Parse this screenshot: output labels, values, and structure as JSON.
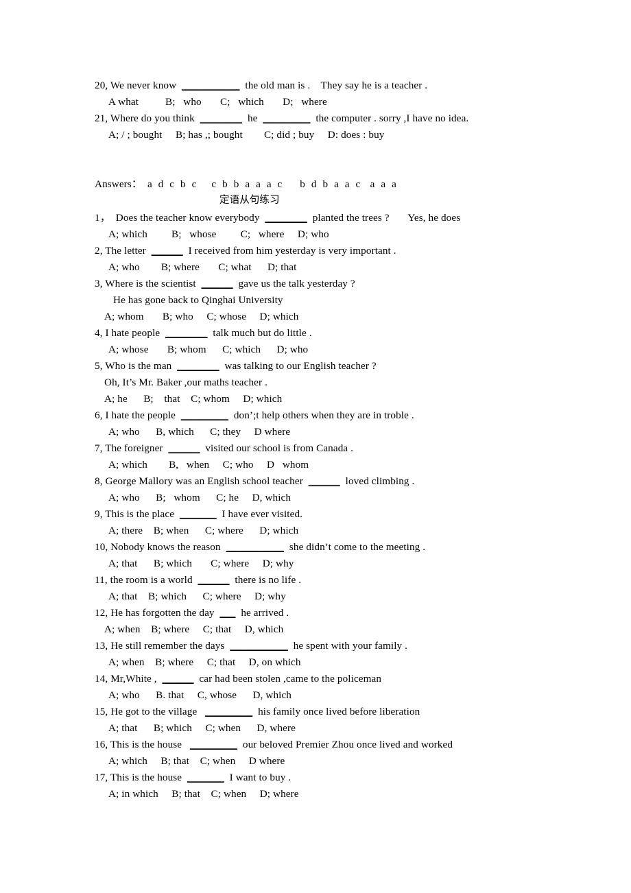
{
  "document": {
    "top_section": {
      "questions": [
        {
          "number": "20,",
          "stem_before": "We never know",
          "blank": "___________",
          "stem_after": "the old man is .    They say he is a teacher .",
          "options": "A what          B;   who       C;   which       D;   where"
        },
        {
          "number": "21,",
          "stem_before": "Where do you think",
          "blank": "________",
          "stem_mid": "he",
          "blank2": "_________",
          "stem_after": "the computer . sorry ,I have no idea.",
          "options": "A; / ; bought     B; has ,; bought        C; did ; buy     D: does : buy"
        }
      ]
    },
    "answers": {
      "label": "Answers：",
      "groups": [
        "a d c b c",
        "c b b a a a c",
        "b d b a a c",
        "a a a"
      ]
    },
    "section_title": "定语从句练习",
    "exercises": [
      {
        "number": "1，",
        "text_before": "Does the teacher know everybody",
        "blank": "________",
        "text_after": "planted the trees ?       Yes, he does",
        "options": "A; which         B;   whose         C;   where     D; who"
      },
      {
        "number": "2,",
        "text_before": "The letter",
        "blank": "______",
        "text_after": "I received from him yesterday is very important .",
        "options": "A; who        B; where       C; what      D; that"
      },
      {
        "number": "3,",
        "text_before": "Where is the scientist",
        "blank": "______",
        "text_after": "gave us the talk yesterday ?",
        "sub_line": "He has gone back to Qinghai University",
        "options": "A; whom       B; who     C; whose     D; which"
      },
      {
        "number": "4,",
        "text_before": "I hate people",
        "blank": "________",
        "text_after": "talk much but do little .",
        "options": "A; whose       B; whom      C; which      D; who"
      },
      {
        "number": "5,",
        "text_before": "Who is the man",
        "blank": "________",
        "text_after": "was talking to our English teacher ?",
        "sub_line": "Oh, It’s Mr. Baker ,our maths teacher .",
        "options": "A; he      B;    that    C; whom     D; which"
      },
      {
        "number": "6,",
        "text_before": "I hate the people",
        "blank": "_________",
        "text_after": "don’;t help others when they are in troble .",
        "options": "A; who      B, which      C; they     D where"
      },
      {
        "number": "7,",
        "text_before": "The foreigner",
        "blank": "______",
        "text_after": "visited our school is from Canada .",
        "options": "A; which        B,   when     C; who     D   whom"
      },
      {
        "number": "8,",
        "text_before": "George Mallory was an English school teacher",
        "blank": "______",
        "text_after": "loved climbing .",
        "options": "A; who      B;   whom      C; he     D, which"
      },
      {
        "number": "9,",
        "text_before": "This is the place",
        "blank": "_______",
        "text_after": "I have ever visited.",
        "options": "A; there    B; when      C; where      D; which"
      },
      {
        "number": "10,",
        "text_before": "Nobody knows the reason",
        "blank": "___________",
        "text_after": "she didn’t come to the meeting .",
        "options": "A; that      B; which       C; where     D; why"
      },
      {
        "number": "11,",
        "text_before": "the room is a world",
        "blank": "______",
        "text_after": "there is no life .",
        "options": "A; that    B; which      C; where     D; why"
      },
      {
        "number": "12,",
        "text_before": "He has forgotten the day",
        "blank": "___",
        "text_after": "he arrived .",
        "options": "A; when    B; where     C; that     D, which"
      },
      {
        "number": "13,",
        "text_before": "He still remember the days",
        "blank": "___________",
        "text_after": "he spent with your family .",
        "options": "A; when    B; where     C; that     D, on which"
      },
      {
        "number": "14,",
        "text_before": "Mr,White ,",
        "blank": "______",
        "text_after": "car had been stolen ,came to the policeman",
        "options": "A; who      B. that     C, whose      D, which"
      },
      {
        "number": "15,",
        "text_before": "He got to the village",
        "blank": "_________",
        "text_after": "his family once lived before liberation",
        "options": "A; that      B; which     C; when      D, where"
      },
      {
        "number": "16,",
        "text_before": "This is the house",
        "blank": "_________",
        "text_after": "our beloved Premier Zhou once lived and worked",
        "options": "A; which     B; that    C; when     D where"
      },
      {
        "number": "17,",
        "text_before": "This is the house",
        "blank": "_______",
        "text_after": "I want to buy .",
        "options": "A; in which     B; that    C; when     D; where"
      }
    ]
  }
}
